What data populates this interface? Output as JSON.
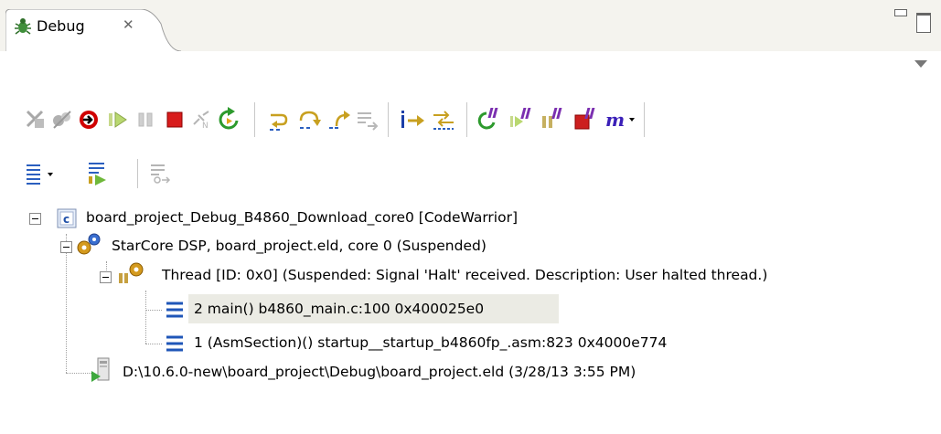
{
  "tab": {
    "label": "Debug",
    "close_glyph": "✕",
    "icon": "debug-bug-icon"
  },
  "window_controls": {
    "minimize": "minimize-icon",
    "maximize": "maximize-icon",
    "menu": "view-menu-chevron-icon"
  },
  "toolbar_icons": [
    "remove-launch-icon",
    "remove-all-terminated-icon",
    "connect-icon",
    "resume-icon",
    "suspend-icon",
    "terminate-icon",
    "disconnect-icon",
    "restart-icon",
    "step-into-icon",
    "step-over-icon",
    "step-return-icon",
    "drop-to-frame-icon",
    "instruction-stepping-icon",
    "use-step-filters-icon",
    "multicore-resume-icon",
    "multicore-suspend-icon",
    "multicore-restart-icon",
    "multicore-terminate-icon",
    "multicore-menu-icon"
  ],
  "toolbar2_icons": [
    "debug-view-layout-icon",
    "step-into-source-icon",
    "show-full-paths-icon"
  ],
  "tree": {
    "root": {
      "icon": "c-project-icon",
      "label": "board_project_Debug_B4860_Download_core0 [CodeWarrior]"
    },
    "core": {
      "icon": "gears-icon",
      "label": "StarCore DSP, board_project.eld, core 0 (Suspended)"
    },
    "thread": {
      "icon": "thread-gears-icon",
      "label": "Thread [ID: 0x0] (Suspended: Signal 'Halt' received. Description: User halted thread.)"
    },
    "frames": [
      {
        "icon": "stack-frame-icon",
        "label": "2 main() b4860_main.c:100 0x400025e0",
        "selected": true
      },
      {
        "icon": "stack-frame-icon",
        "label": "1 (AsmSection)() startup__startup_b4860fp_.asm:823 0x4000e774",
        "selected": false
      }
    ],
    "process": {
      "icon": "process-icon",
      "label": "D:\\10.6.0-new\\board_project\\Debug\\board_project.eld (3/28/13 3:55 PM)"
    }
  },
  "colors": {
    "tab_bg": "#f4f3ee",
    "selection": "#ebebe4",
    "frame_icon": "#1f56b8",
    "multicore_red": "#cc1f1f"
  }
}
